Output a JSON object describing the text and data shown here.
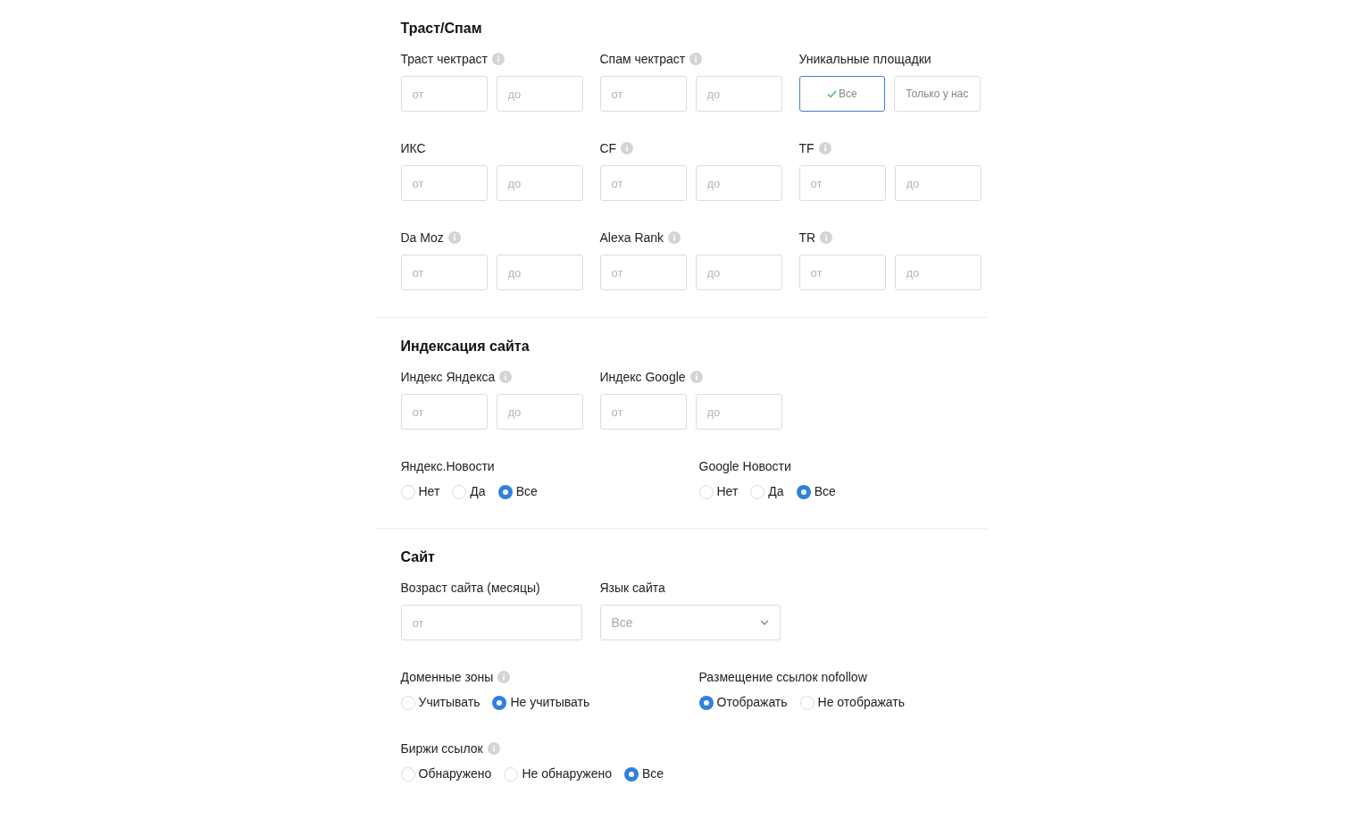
{
  "sections": [
    {
      "title": "Траст/Спам",
      "rows": [
        {
          "fields": [
            {
              "kind": "range",
              "label": "Траст чектраст",
              "info": true,
              "placeholders": [
                "от",
                "до"
              ]
            },
            {
              "kind": "range",
              "label": "Спам чектраст",
              "info": true,
              "placeholders": [
                "от",
                "до"
              ]
            },
            {
              "kind": "toggle",
              "label": "Уникальные площадки",
              "info": false,
              "options": [
                {
                  "label": "Все",
                  "selected": true
                },
                {
                  "label": "Только у нас",
                  "selected": false
                }
              ]
            }
          ]
        },
        {
          "fields": [
            {
              "kind": "range",
              "label": "ИКС",
              "info": false,
              "placeholders": [
                "от",
                "до"
              ]
            },
            {
              "kind": "range",
              "label": "CF",
              "info": true,
              "placeholders": [
                "от",
                "до"
              ]
            },
            {
              "kind": "range",
              "label": "TF",
              "info": true,
              "placeholders": [
                "от",
                "до"
              ]
            }
          ]
        },
        {
          "fields": [
            {
              "kind": "range",
              "label": "Da Moz",
              "info": true,
              "placeholders": [
                "от",
                "до"
              ]
            },
            {
              "kind": "range",
              "label": "Alexa Rank",
              "info": true,
              "placeholders": [
                "от",
                "до"
              ]
            },
            {
              "kind": "range",
              "label": "TR",
              "info": true,
              "placeholders": [
                "от",
                "до"
              ]
            }
          ]
        }
      ]
    },
    {
      "title": "Индексация сайта",
      "rows": [
        {
          "fields": [
            {
              "kind": "range",
              "label": "Индекс Яндекса",
              "info": true,
              "placeholders": [
                "от",
                "до"
              ]
            },
            {
              "kind": "range",
              "label": "Индекс Google",
              "info": true,
              "placeholders": [
                "от",
                "до"
              ]
            }
          ]
        },
        {
          "fields": [
            {
              "kind": "radio",
              "label": "Яндекс.Новости",
              "info": false,
              "options": [
                {
                  "label": "Нет",
                  "selected": false
                },
                {
                  "label": "Да",
                  "selected": false
                },
                {
                  "label": "Все",
                  "selected": true
                }
              ]
            },
            {
              "kind": "radio",
              "label": "Google Новости",
              "info": false,
              "options": [
                {
                  "label": "Нет",
                  "selected": false
                },
                {
                  "label": "Да",
                  "selected": false
                },
                {
                  "label": "Все",
                  "selected": true
                }
              ]
            }
          ]
        }
      ]
    },
    {
      "title": "Сайт",
      "rows": [
        {
          "fields": [
            {
              "kind": "single",
              "label": "Возраст сайта (месяцы)",
              "info": false,
              "placeholder": "от"
            },
            {
              "kind": "select",
              "label": "Язык сайта",
              "info": false,
              "value": "Все"
            }
          ]
        },
        {
          "fields": [
            {
              "kind": "radio",
              "label": "Доменные зоны",
              "info": true,
              "options": [
                {
                  "label": "Учитывать",
                  "selected": false
                },
                {
                  "label": "Не учитывать",
                  "selected": true
                }
              ]
            },
            {
              "kind": "radio",
              "label": "Размещение ссылок nofollow",
              "info": false,
              "options": [
                {
                  "label": "Отображать",
                  "selected": true
                },
                {
                  "label": "Не отображать",
                  "selected": false
                }
              ]
            }
          ]
        },
        {
          "fields": [
            {
              "kind": "radio",
              "label": "Биржи ссылок",
              "info": true,
              "options": [
                {
                  "label": "Обнаружено",
                  "selected": false
                },
                {
                  "label": "Не обнаружено",
                  "selected": false
                },
                {
                  "label": "Все",
                  "selected": true
                }
              ]
            }
          ]
        }
      ]
    }
  ]
}
